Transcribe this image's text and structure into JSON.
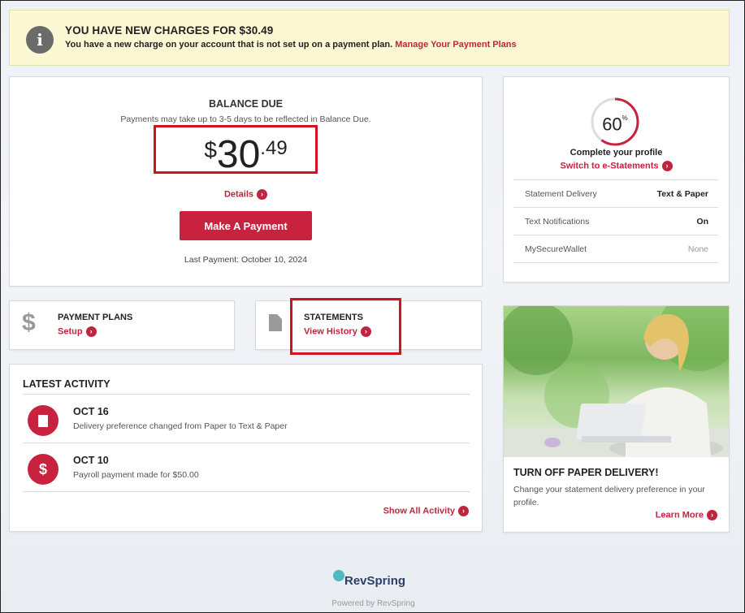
{
  "alert": {
    "icon": "info-icon",
    "title": "YOU HAVE NEW CHARGES FOR $30.49",
    "message": "You have a new charge on your account that is not set up on a payment plan.",
    "link": "Manage Your Payment Plans"
  },
  "balance": {
    "label": "BALANCE DUE",
    "note": "Payments may take up to 3-5 days to be reflected in Balance Due.",
    "currency": "$",
    "dollars": "30",
    "cents": ".49",
    "details": "Details",
    "pay_button": "Make A Payment",
    "last_payment": "Last Payment: October 10, 2024"
  },
  "profile": {
    "percent": "60",
    "percent_sign": "%",
    "percent_value": 0.6,
    "complete": "Complete your profile",
    "switch": "Switch to e-Statements",
    "rows": [
      {
        "key": "Statement Delivery",
        "value": "Text & Paper"
      },
      {
        "key": "Text Notifications",
        "value": "On"
      },
      {
        "key": "MySecureWallet",
        "value": "None"
      }
    ]
  },
  "plans": {
    "icon": "dollar-icon",
    "label": "PAYMENT PLANS",
    "link": "Setup"
  },
  "statements": {
    "icon": "document-icon",
    "label": "STATEMENTS",
    "link": "View History"
  },
  "activity": {
    "heading": "LATEST ACTIVITY",
    "items": [
      {
        "icon": "document-icon",
        "date": "OCT 16",
        "desc": "Delivery preference changed from Paper to Text & Paper"
      },
      {
        "icon": "dollar-icon",
        "date": "OCT 10",
        "desc": "Payroll payment made for $50.00"
      }
    ],
    "show_all": "Show All Activity"
  },
  "promo": {
    "title": "TURN OFF PAPER DELIVERY!",
    "text": "Change your statement delivery preference in your profile.",
    "link": "Learn More"
  },
  "footer": {
    "brand": "RevSpring",
    "powered": "Powered by RevSpring"
  },
  "colors": {
    "accent": "#c0253f",
    "highlight": "#d0141e",
    "alert_bg": "#fbf8d3"
  }
}
